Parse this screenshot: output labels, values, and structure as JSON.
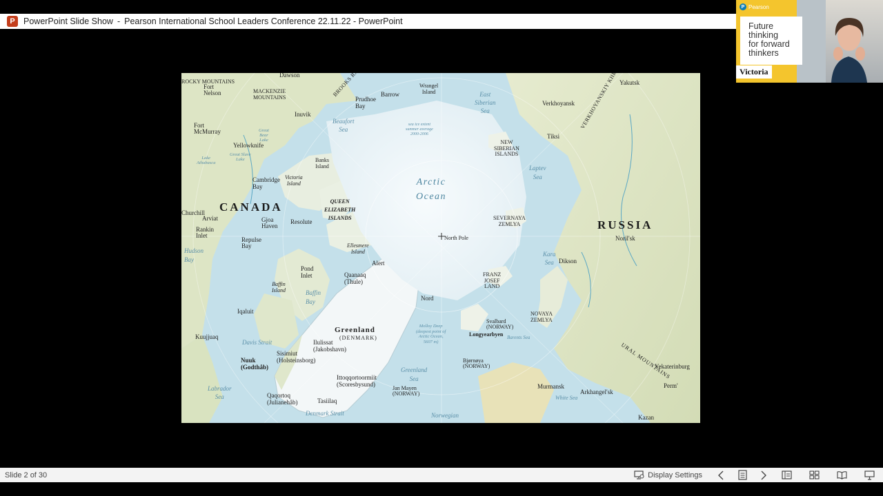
{
  "window": {
    "app_name": "PowerPoint Slide Show",
    "separator": "-",
    "document_title": "Pearson International School Leaders Conference 22.11.22 - PowerPoint",
    "icon": "powerpoint-icon"
  },
  "map": {
    "countries": [
      "CANADA",
      "RUSSIA"
    ],
    "ocean_name": "Arctic\nOcean",
    "greenland": "Greenland",
    "denmark": "(DENMARK)",
    "places": {
      "dawson": "Dawson",
      "rocky": "ROCKY MOUNTAINS",
      "fort_nelson": "Fort\nNelson",
      "mackenzie": "MACKENZIE\nMOUNTAINS",
      "inuvik": "Inuvik",
      "prudhoe": "Prudhoe\nBay",
      "barrow": "Barrow",
      "wrangel": "Wrangel\nIsland",
      "east_siberian": "East\nSiberian\nSea",
      "beaufort": "Beaufort\nSea",
      "sea_ice": "sea ice extent\nsummer average\n2000-2006",
      "fort_mcmurray": "Fort\nMcMurray",
      "yellowknife": "Yellowknife",
      "banks": "Banks\nIsland",
      "victoria_island": "Victoria\nIsland",
      "cambridge": "Cambridge\nBay",
      "queen": "QUEEN\nELIZABETH\nISLANDS",
      "resolute": "Resolute",
      "churchill": "Churchill",
      "arviat": "Arviat",
      "rankin": "Rankin\nInlet",
      "gjoa": "Gjoa\nHaven",
      "repulse": "Repulse\nBay",
      "hudson": "Hudson\nBay",
      "ellesmere": "Ellesmere\nIsland",
      "alert": "Alert",
      "pond": "Pond\nInlet",
      "qaanaaq": "Qaanaaq\n(Thule)",
      "baffin_island": "Baffin\nIsland",
      "baffin_bay": "Baffin\nBay",
      "iqaluit": "Iqaluit",
      "kuujjuaq": "Kuujjuaq",
      "davis": "Davis Strait",
      "ilulissat": "Ilulissat\n(Jakobshavn)",
      "sisimiut": "Sisimiut\n(Holsteinsborg)",
      "nuuk": "Nuuk\n(Godthåb)",
      "labrador": "Labrador\nSea",
      "qaqortoq": "Qaqortoq\n(Julianehåb)",
      "tasiilaq": "Tasiilaq",
      "denmark_strait": "Denmark Strait",
      "ittoqqortoormiit": "Ittoqqortoormiit\n(Scoresbysund)",
      "greenland_sea": "Greenland\nSea",
      "jan_mayen": "Jan Mayen\n(NORWAY)",
      "nord": "Nord",
      "molloy": "Molloy Deep\n(deepest point of\nArctic Ocean,\n5607 m)",
      "north_pole": "North Pole",
      "franz_josef": "FRANZ\nJOSEF\nLAND",
      "svalbard": "Svalbard\n(NORWAY)",
      "longyearbyen": "Longyearbyen",
      "bjornoya": "Bjørnøya\n(NORWAY)",
      "norwegian": "Norwegian",
      "murmansk": "Murmansk",
      "white_sea": "White Sea",
      "arkhangelsk": "Arkhangel'sk",
      "kazan": "Kazan",
      "perm": "Perm'",
      "yekaterinburg": "Yekaterinburg",
      "ural": "URAL MOUNTAINS",
      "novaya": "NOVAYA\nZEMLYA",
      "kara": "Kara\nSea",
      "dikson": "Dikson",
      "norilsk": "Noril'sk",
      "severnaya": "SEVERNAYA\nZEMLYA",
      "laptev": "Laptev\nSea",
      "new_siberian": "NEW\nSIBERIAN\nISLANDS",
      "tiksi": "Tiksi",
      "verkhoyansk": "Verkhoyansk",
      "verkhoyansk_range": "VERKHOYANSKIY KHREBET",
      "yakutsk": "Yakutsk",
      "brooks": "BROOKS RANGE",
      "great_slave": "Great Slave\nLake",
      "athabasca": "Lake\nAthabasca",
      "great_bear": "Great\nBear\nLake",
      "barents": "Barents Sea"
    }
  },
  "webcam": {
    "brand": "Pearson",
    "tagline": "Future\nthinking\nfor forward\nthinkers",
    "participant_name": "Victoria"
  },
  "status": {
    "slide_counter": "Slide 2 of 30",
    "display_settings": "Display Settings"
  },
  "colors": {
    "powerpoint": "#c43e1c",
    "pearson_yellow": "#f4c52d",
    "pearson_blue": "#0a7cb7",
    "land": "#dfe6c6",
    "sea_ice": "#eef5f8",
    "water": "#bcdde8"
  }
}
